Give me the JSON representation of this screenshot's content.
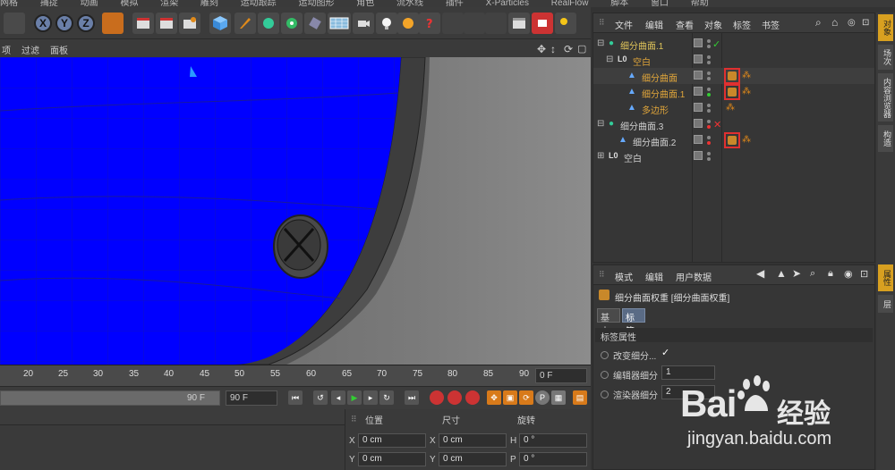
{
  "menubar": {
    "items": [
      "网格",
      "捕捉",
      "动画",
      "模拟",
      "渲染",
      "雕刻",
      "运动跟踪",
      "运动图形",
      "角色",
      "流水线",
      "插件",
      "X-Particles",
      "RealFlow",
      "脚本",
      "窗口",
      "帮助"
    ]
  },
  "toolbar": {
    "xyz": [
      "X",
      "Y",
      "Z"
    ]
  },
  "viewport_menu": {
    "items": [
      "项",
      "过滤",
      "面板"
    ]
  },
  "timeline": {
    "ticks": [
      "20",
      "25",
      "30",
      "35",
      "40",
      "45",
      "50",
      "55",
      "60",
      "65",
      "70",
      "75",
      "80",
      "85",
      "90"
    ],
    "frame_field": "0 F"
  },
  "playbar": {
    "end_frame_a": "90 F",
    "end_frame_b": "90 F"
  },
  "coords": {
    "headers": [
      "位置",
      "尺寸",
      "旋转"
    ],
    "row_x": {
      "label": "X",
      "pos": "0 cm",
      "size_label": "X",
      "size": "0 cm",
      "rot_label": "H",
      "rot": "0 °"
    },
    "row_y": {
      "label": "Y",
      "pos": "0 cm",
      "size_label": "Y",
      "size": "0 cm",
      "rot_label": "P",
      "rot": "0 °"
    }
  },
  "object_manager": {
    "menu": [
      "文件",
      "编辑",
      "查看",
      "对象",
      "标签",
      "书签"
    ],
    "rows": [
      {
        "name": "细分曲面.1",
        "status": "✓",
        "name_color": "#e0c45a"
      },
      {
        "name": "空白",
        "status": "",
        "name_color": "#e0a53a"
      },
      {
        "name": "细分曲面",
        "status": "",
        "name_color": "#e0a53a"
      },
      {
        "name": "细分曲面.1",
        "status": "",
        "name_color": "#e0a53a"
      },
      {
        "name": "多边形",
        "status": "",
        "name_color": "#e0a53a"
      },
      {
        "name": "细分曲面.3",
        "status": "✕",
        "name_color": "#d0d0d0"
      },
      {
        "name": "细分曲面.2",
        "status": "",
        "name_color": "#d0d0d0"
      },
      {
        "name": "空白",
        "status": "",
        "name_color": "#d0d0d0"
      }
    ]
  },
  "attributes": {
    "menu": [
      "模式",
      "编辑",
      "用户数据"
    ],
    "title": "细分曲面权重 [细分曲面权重]",
    "tabs": [
      "基本",
      "标签"
    ],
    "section": "标签属性",
    "fields": [
      {
        "label": "改变细分...",
        "value": "✓"
      },
      {
        "label": "编辑器细分",
        "value": "1"
      },
      {
        "label": "渲染器细分",
        "value": "2"
      }
    ]
  },
  "side_tabs": [
    "对象",
    "场次",
    "内容浏览器",
    "构造",
    "属性",
    "层"
  ],
  "watermark": {
    "brand": "Bai",
    "brand2": "经验",
    "url": "jingyan.baidu.com"
  },
  "colors": {
    "viewport_blue": "#0000ff",
    "tag_highlight": "#e03030",
    "accent_orange": "#e0a53a"
  }
}
